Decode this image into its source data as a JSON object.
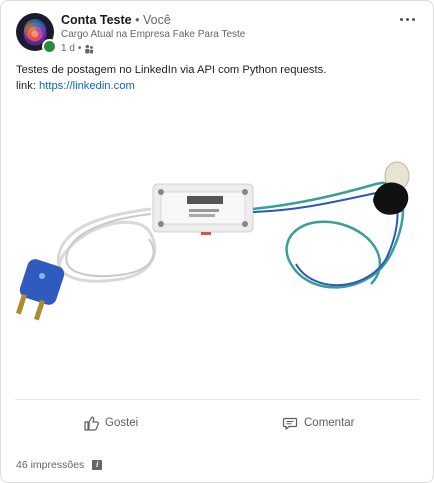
{
  "author": {
    "name": "Conta Teste",
    "separator": "•",
    "relation": "Você",
    "headline": "Cargo Atual na Empresa Fake Para Teste",
    "time": "1 d",
    "time_separator": "•"
  },
  "post": {
    "text": "Testes de postagem no LinkedIn via API com Python requests.",
    "link_prefix": "link: ",
    "link_text": "https://linkedin.com",
    "media_description_icon": "photo-of-sonoff-smart-switch-with-plug-and-bulb"
  },
  "actions": {
    "like_label": "Gostei",
    "comment_label": "Comentar"
  },
  "stats": {
    "impressions": "46 impressões"
  },
  "colors": {
    "link": "#0a66c2",
    "online": "#2e8a3a",
    "text_secondary": "#666666"
  },
  "icons": {
    "more": "more-horizontal-icon",
    "visibility": "people-icon",
    "like": "thumbs-up-icon",
    "comment": "comment-icon",
    "info": "info-icon"
  }
}
